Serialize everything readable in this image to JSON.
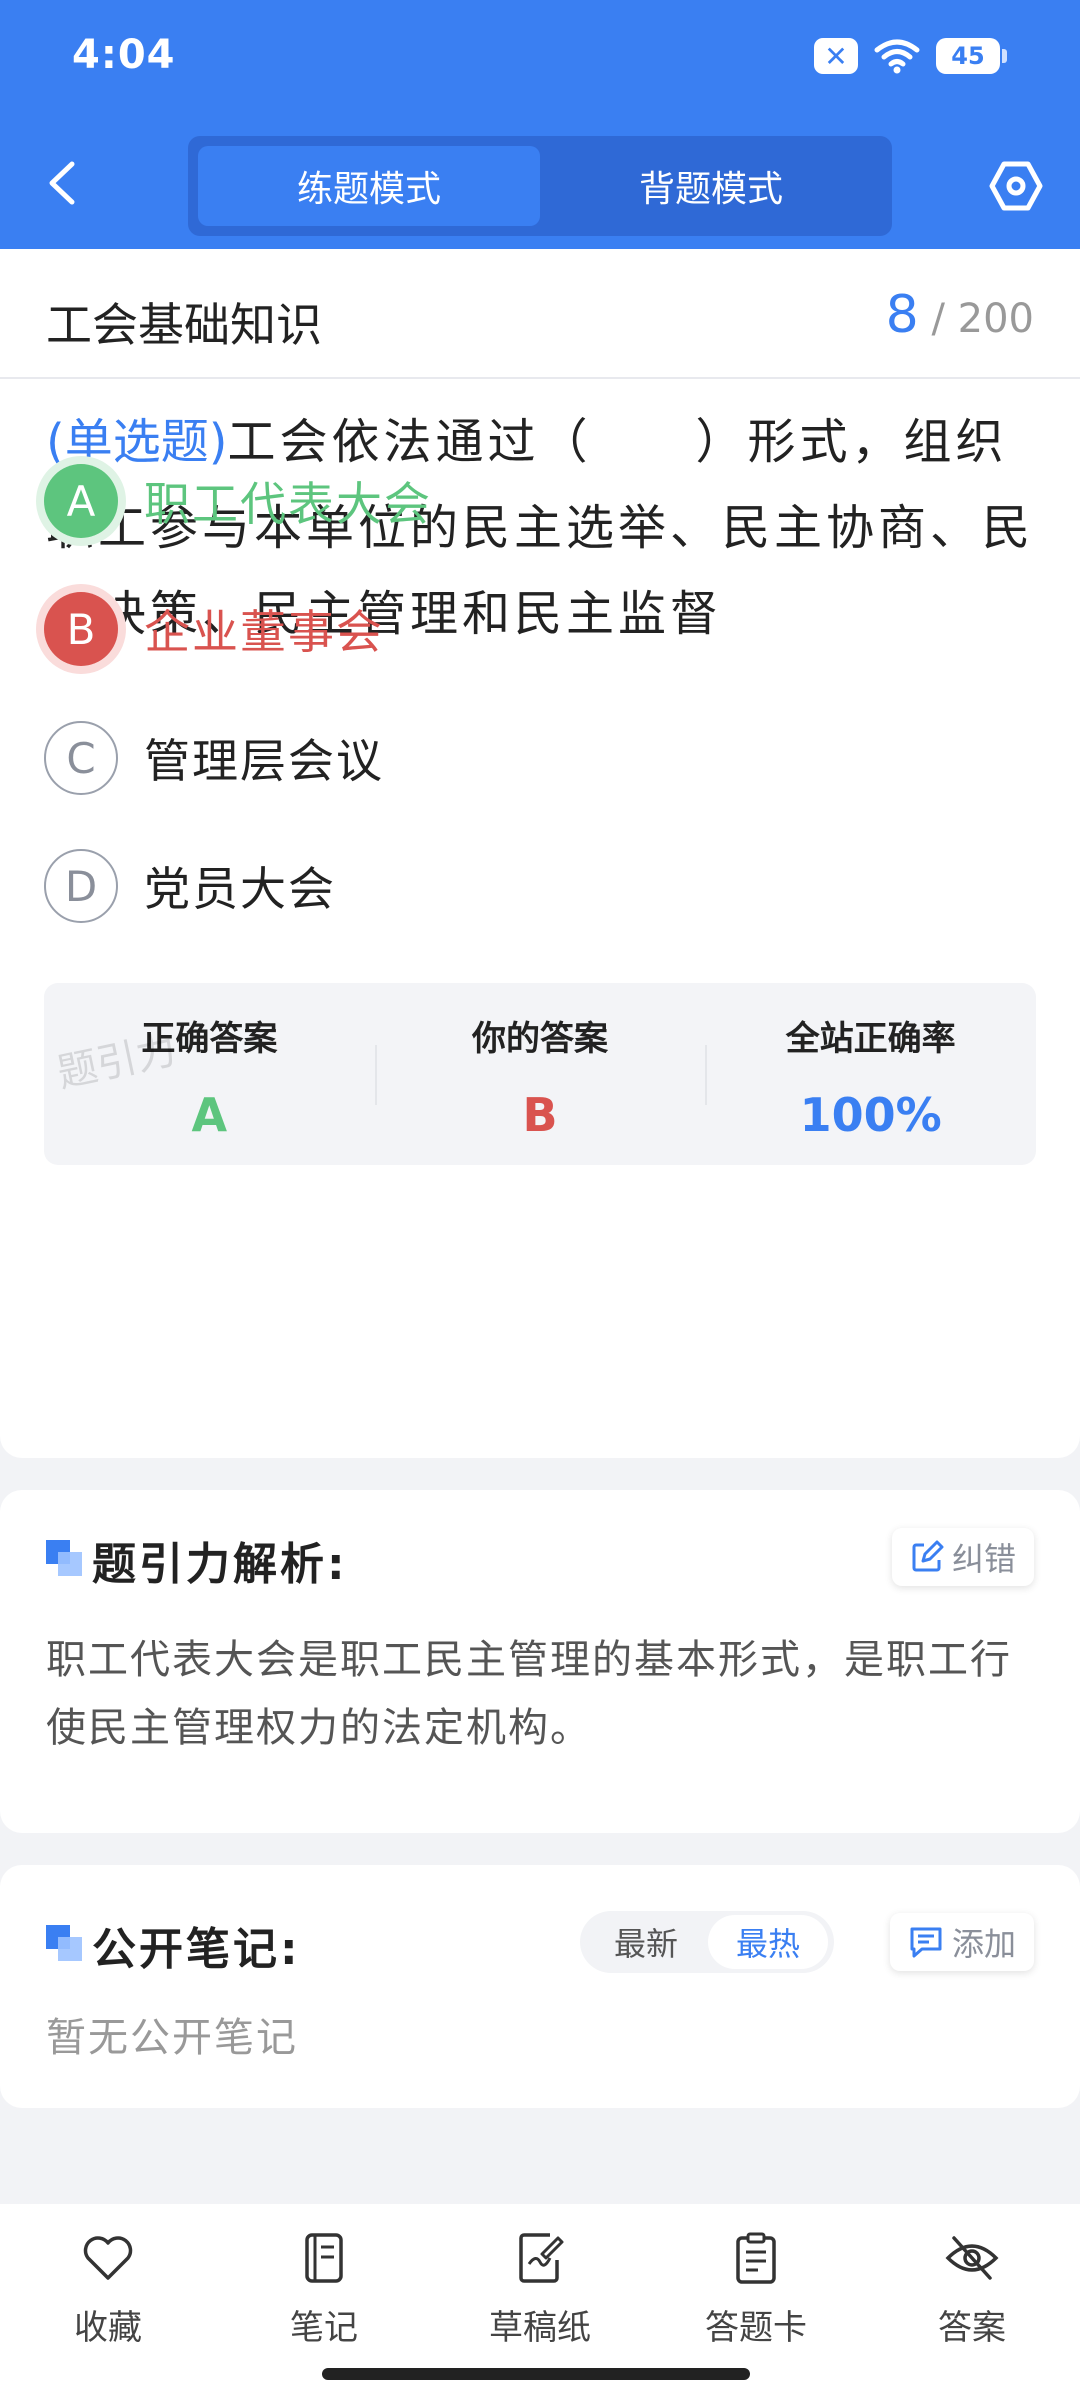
{
  "status_bar": {
    "time": "4:04",
    "battery": "45",
    "sim_icon": "x-badge-icon",
    "wifi_icon": "wifi-icon"
  },
  "header": {
    "back_icon": "chevron-left-icon",
    "modes": [
      "练题模式",
      "背题模式"
    ],
    "active_mode": "练题模式",
    "settings_icon": "hexagon-gear-icon",
    "accent_color": "#3a7ff2"
  },
  "topic": {
    "title": "工会基础知识",
    "current": "8",
    "total": "/ 200"
  },
  "question": {
    "type": "(单选题)",
    "text": "工会依法通过（　　）形式，组织职工参与本单位的民主选举、民主协商、民主决策、民主管理和民主监督"
  },
  "options": [
    {
      "letter": "A",
      "text": "职工代表大会",
      "state": "correct"
    },
    {
      "letter": "B",
      "text": "企业董事会",
      "state": "wrong"
    },
    {
      "letter": "C",
      "text": "管理层会议",
      "state": "none"
    },
    {
      "letter": "D",
      "text": "党员大会",
      "state": "none"
    }
  ],
  "answer_summary": {
    "correct_label": "正确答案",
    "correct_value": "A",
    "yours_label": "你的答案",
    "yours_value": "B",
    "rate_label": "全站正确率",
    "rate_value": "100%",
    "watermark": "题引力"
  },
  "analysis": {
    "title": "题引力解析:",
    "report_label": "纠错",
    "text": "职工代表大会是职工民主管理的基本形式，是职工行使民主管理权力的法定机构。"
  },
  "notes": {
    "title": "公开笔记:",
    "sort_options": [
      "最新",
      "最热"
    ],
    "active_sort": "最热",
    "add_label": "添加",
    "empty_text": "暂无公开笔记"
  },
  "bottom_nav": [
    {
      "label": "收藏",
      "icon": "heart-icon"
    },
    {
      "label": "笔记",
      "icon": "notebook-icon"
    },
    {
      "label": "草稿纸",
      "icon": "draft-paper-icon"
    },
    {
      "label": "答题卡",
      "icon": "answer-sheet-icon"
    },
    {
      "label": "答案",
      "icon": "eye-off-icon"
    }
  ],
  "colors": {
    "correct": "#5dc57e",
    "wrong": "#d9534f",
    "primary": "#3a7ff2"
  }
}
